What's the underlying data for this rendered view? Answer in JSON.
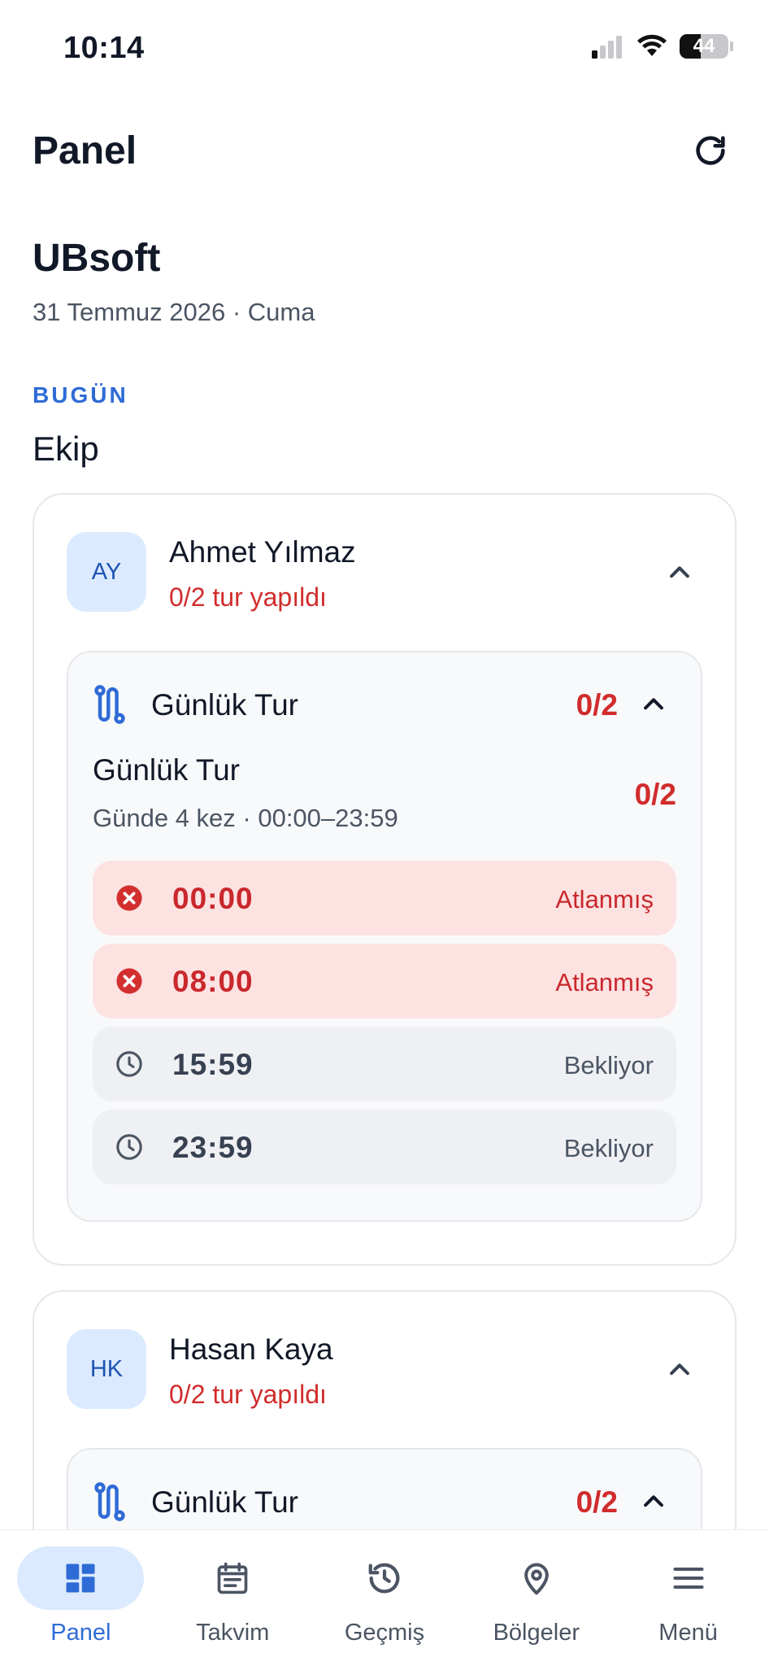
{
  "status_bar": {
    "time": "10:14",
    "battery": "44"
  },
  "header": {
    "title": "Panel"
  },
  "company": {
    "name": "UBsoft",
    "date": "31 Temmuz 2026 · Cuma"
  },
  "section": {
    "kicker": "BUGÜN",
    "title": "Ekip"
  },
  "members": [
    {
      "initials": "AY",
      "name": "Ahmet Yılmaz",
      "progress": "0/2 tur yapıldı",
      "tour": {
        "title": "Günlük Tur",
        "count": "0/2",
        "plan_name": "Günlük Tur",
        "plan_sub": "Günde 4 kez · 00:00–23:59",
        "plan_count": "0/2",
        "slots": [
          {
            "time": "00:00",
            "status": "Atlanmış",
            "state": "missed"
          },
          {
            "time": "08:00",
            "status": "Atlanmış",
            "state": "missed"
          },
          {
            "time": "15:59",
            "status": "Bekliyor",
            "state": "pending"
          },
          {
            "time": "23:59",
            "status": "Bekliyor",
            "state": "pending"
          }
        ]
      }
    },
    {
      "initials": "HK",
      "name": "Hasan Kaya",
      "progress": "0/2 tur yapıldı",
      "tour": {
        "title": "Günlük Tur",
        "count": "0/2"
      }
    }
  ],
  "nav": {
    "items": [
      {
        "label": "Panel",
        "icon": "dashboard-icon",
        "active": true
      },
      {
        "label": "Takvim",
        "icon": "calendar-icon",
        "active": false
      },
      {
        "label": "Geçmiş",
        "icon": "history-icon",
        "active": false
      },
      {
        "label": "Bölgeler",
        "icon": "location-pin-icon",
        "active": false
      },
      {
        "label": "Menü",
        "icon": "menu-icon",
        "active": false
      }
    ]
  },
  "colors": {
    "accent": "#2f6bd6",
    "danger": "#d12c2c",
    "missed_bg": "#fde2e2",
    "pending_bg": "#eef0f3",
    "avatar_bg": "#dbeafe"
  }
}
